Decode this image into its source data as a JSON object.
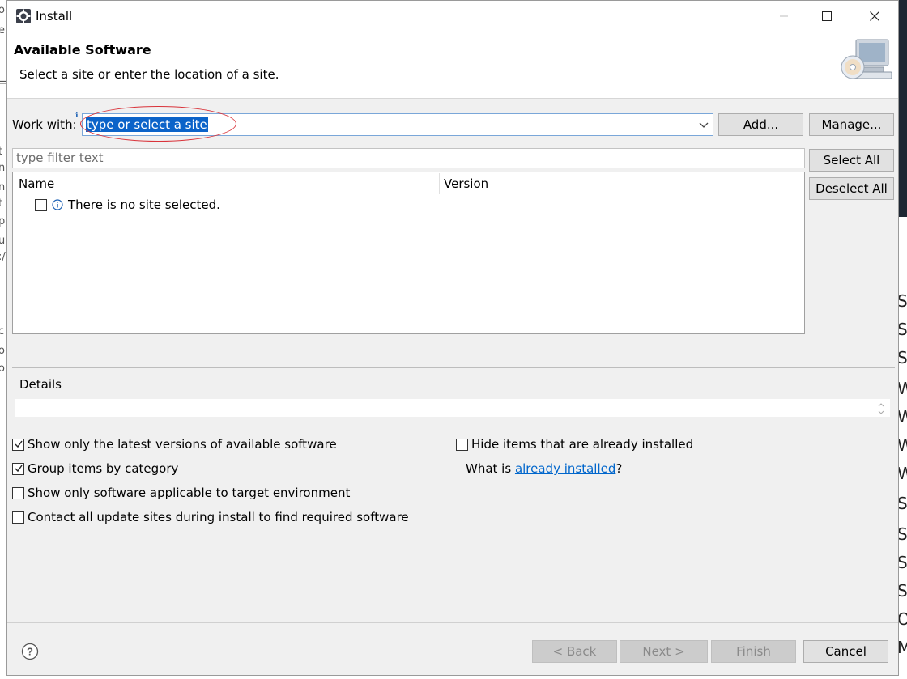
{
  "window": {
    "title": "Install"
  },
  "header": {
    "title": "Available Software",
    "description": "Select a site or enter the location of a site."
  },
  "work_with": {
    "label": "Work with:",
    "value": "type or select a site",
    "add_label": "Add...",
    "manage_label": "Manage..."
  },
  "filter": {
    "placeholder": "type filter text"
  },
  "selection": {
    "select_all_label": "Select All",
    "deselect_all_label": "Deselect All"
  },
  "table": {
    "columns": [
      "Name",
      "Version"
    ],
    "rows": [
      {
        "checked": false,
        "text": "There is no site selected."
      }
    ]
  },
  "details": {
    "label": "Details"
  },
  "options": {
    "show_latest": {
      "label": "Show only the latest versions of available software",
      "checked": true
    },
    "group_by_category": {
      "label": "Group items by category",
      "checked": true
    },
    "show_applicable": {
      "label": "Show only software applicable to target environment",
      "checked": false
    },
    "contact_all_sites": {
      "label": "Contact all update sites during install to find required software",
      "checked": false
    },
    "hide_installed": {
      "label": "Hide items that are already installed",
      "checked": false
    },
    "what_is_prefix": "What is ",
    "what_is_link": "already installed",
    "what_is_suffix": "?"
  },
  "footer": {
    "back_label": "< Back",
    "next_label": "Next >",
    "finish_label": "Finish",
    "cancel_label": "Cancel"
  },
  "colors": {
    "selection_blue": "#0b63c9",
    "link_blue": "#0066cc",
    "highlight_red": "#d9333a",
    "dialog_bg": "#f0f0f0"
  }
}
